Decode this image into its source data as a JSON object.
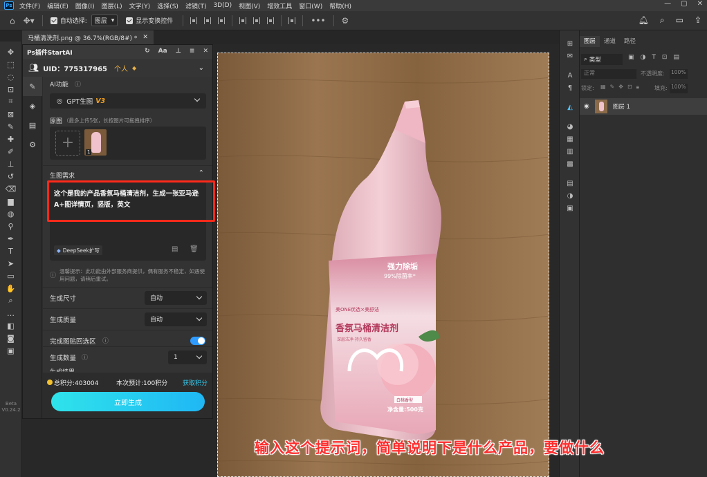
{
  "menubar": {
    "items": [
      "文件(F)",
      "编辑(E)",
      "图像(I)",
      "图层(L)",
      "文字(Y)",
      "选择(S)",
      "滤镜(T)",
      "3D(D)",
      "视图(V)",
      "增效工具",
      "窗口(W)",
      "帮助(H)"
    ],
    "ps_logo": "Ps"
  },
  "options": {
    "auto_select_label": "自动选择:",
    "auto_select_value": "图层",
    "show_transform_label": "显示变换控件"
  },
  "doc": {
    "tab_title": "马桶清洗剂.png @ 36.7%(RGB/8#) *",
    "close": "✕"
  },
  "toolbar": {
    "version_line1": "Beta",
    "version_line2": "V0.24.2"
  },
  "plugin": {
    "title": "Ps插件StartAI",
    "uid": "UID：775317965",
    "personal": "个人",
    "ai_function_label": "AI功能",
    "ai_function_value": "GPT生图",
    "ai_function_version": "V3",
    "original_label": "原图",
    "original_hint": "（最多上传5张，长按图片可拖拽排序）",
    "thumb_index": "1",
    "requirement_label": "生图需求",
    "prompt_text": "这个是我的产品香氛马桶清洁剂，生成一张亚马逊A+图详情页，竖版，英文",
    "deepseek_label": "DeepSeek扩写",
    "tip": "温馨提示：此功能由外部服务商提供，偶有服务不稳定，如遇使用问题，请稍后重试。",
    "size_label": "生成尺寸",
    "size_value": "自动",
    "quality_label": "生成质量",
    "quality_value": "自动",
    "paste_back_label": "完成图贴回选区",
    "count_label": "生成数量",
    "count_value": "1",
    "partial_label": "生成结果",
    "points_total": "总积分:403004",
    "points_estimate": "本次预计:100积分",
    "get_points": "获取积分",
    "generate_button": "立即生成"
  },
  "layers_panel": {
    "tabs": [
      "图层",
      "通道",
      "路径"
    ],
    "kind": "类型",
    "blend": "正常",
    "opacity_label": "不透明度:",
    "opacity_value": "100%",
    "lock_label": "锁定:",
    "fill_label": "填充:",
    "fill_value": "100%",
    "layer_name": "图层 1"
  },
  "product_label": {
    "strong": "强力除垢",
    "rate": "99%除菌率*",
    "brand": "美ONE优选×美舒洁",
    "name": "香氛马桶清洁剂",
    "sub": "深层洁净·持久留香",
    "scent": "白桃香型",
    "net": "净含量:500克"
  },
  "caption": "输入这个提示词，简单说明下是什么产品，要做什么",
  "colors": {
    "accent_gradient_start": "#2fe3ea",
    "accent_gradient_end": "#1fb7f5",
    "highlight_red": "#ff2d2d",
    "toggle_blue": "#2f9bff"
  }
}
